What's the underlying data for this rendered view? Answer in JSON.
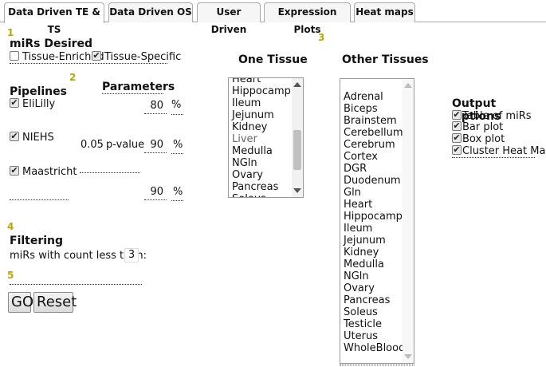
{
  "tabs": [
    {
      "label": "Data Driven TE & TS",
      "active": true
    },
    {
      "label": "Data Driven OS",
      "active": false
    },
    {
      "label": "User Driven",
      "active": false
    },
    {
      "label": "Expression Plots",
      "active": false
    },
    {
      "label": "Heat maps",
      "active": false
    }
  ],
  "steps": [
    "1",
    "2",
    "3",
    "4",
    "5"
  ],
  "mirs_desired": {
    "title": "miRs Desired",
    "tissue_enriched": {
      "label": "Tissue-Enriched",
      "checked": false
    },
    "tissue_specific": {
      "label": "Tissue-Specific",
      "checked": true
    }
  },
  "pipelines": {
    "title": "Pipelines",
    "items": [
      {
        "label": "EliLilly",
        "checked": true
      },
      {
        "label": "NIEHS",
        "checked": true
      },
      {
        "label": "Maastricht",
        "checked": true
      }
    ]
  },
  "parameters": {
    "title": "Parameters",
    "elililly_value": "80",
    "niehs_pvalue": "0.05",
    "pvalue_label": "p-value",
    "niehs_value": "90",
    "maastricht_value": "90",
    "percent": "%"
  },
  "one_tissue": {
    "title": "One Tissue",
    "items": [
      "Heart",
      "Hippocampus",
      "Ileum",
      "Jejunum",
      "Kidney",
      "Liver",
      "Medulla",
      "NGln",
      "Ovary",
      "Pancreas",
      "Soleus"
    ]
  },
  "other_tissues": {
    "title": "Other Tissues",
    "items": [
      "Adrenal",
      "Biceps",
      "Brainstem",
      "Cerebellum",
      "Cerebrum",
      "Cortex",
      "DGR",
      "Duodenum",
      "Gln",
      "Heart",
      "Hippocampus",
      "Ileum",
      "Jejunum",
      "Kidney",
      "Medulla",
      "NGln",
      "Ovary",
      "Pancreas",
      "Soleus",
      "Testicle",
      "Uterus",
      "WholeBlood"
    ]
  },
  "output_options": {
    "title": "Output Options",
    "items": [
      {
        "label": "Table of miRs",
        "checked": true
      },
      {
        "label": "Bar plot",
        "checked": true
      },
      {
        "label": "Box plot",
        "checked": true
      },
      {
        "label": "Cluster Heat Map",
        "checked": true
      }
    ]
  },
  "filtering": {
    "title": "Filtering",
    "count_label": "miRs with count less than:",
    "count_value": "3"
  },
  "buttons": {
    "go": "GO",
    "reset": "Reset"
  }
}
